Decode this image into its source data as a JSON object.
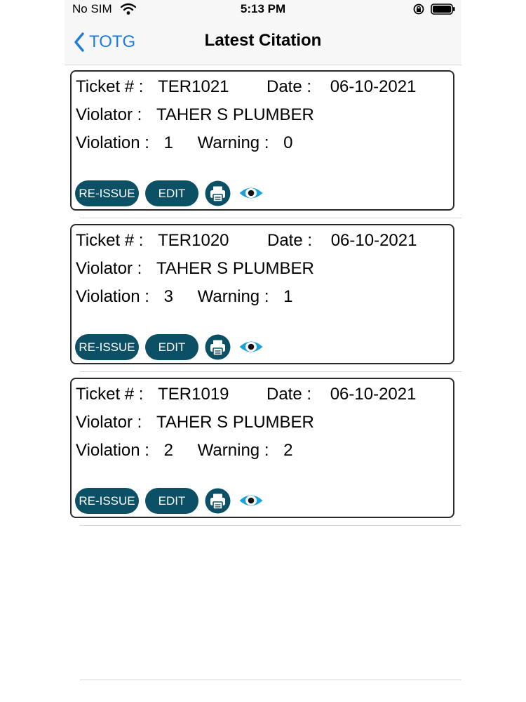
{
  "status_bar": {
    "carrier": "No SIM",
    "time": "5:13 PM"
  },
  "nav": {
    "back_label": "TOTG",
    "title": "Latest Citation"
  },
  "labels": {
    "ticket": "Ticket # :",
    "date": "Date :",
    "violator": "Violator :",
    "violation": "Violation :",
    "warning": "Warning :"
  },
  "citations": [
    {
      "ticket": "TER1021",
      "date": "06-10-2021",
      "violator": "TAHER S PLUMBER",
      "violation": "1",
      "warning": "0",
      "reissue_label": "RE-ISSUE",
      "edit_label": "EDIT"
    },
    {
      "ticket": "TER1020",
      "date": "06-10-2021",
      "violator": "TAHER S PLUMBER",
      "violation": "3",
      "warning": "1",
      "reissue_label": "RE-ISSUE",
      "edit_label": "EDIT"
    },
    {
      "ticket": "TER1019",
      "date": "06-10-2021",
      "violator": "TAHER S PLUMBER",
      "violation": "2",
      "warning": "2",
      "reissue_label": "RE-ISSUE",
      "edit_label": "EDIT"
    }
  ],
  "icons": {
    "back": "chevron-left-icon",
    "print": "printer-icon",
    "view": "eye-icon",
    "wifi": "wifi-icon",
    "lock": "orientation-lock-icon",
    "battery": "battery-icon"
  },
  "colors": {
    "accent": "#1e7be0",
    "button_bg": "#0c5066",
    "eye": "#1aa3d9",
    "card_border": "#2a2a2a"
  }
}
